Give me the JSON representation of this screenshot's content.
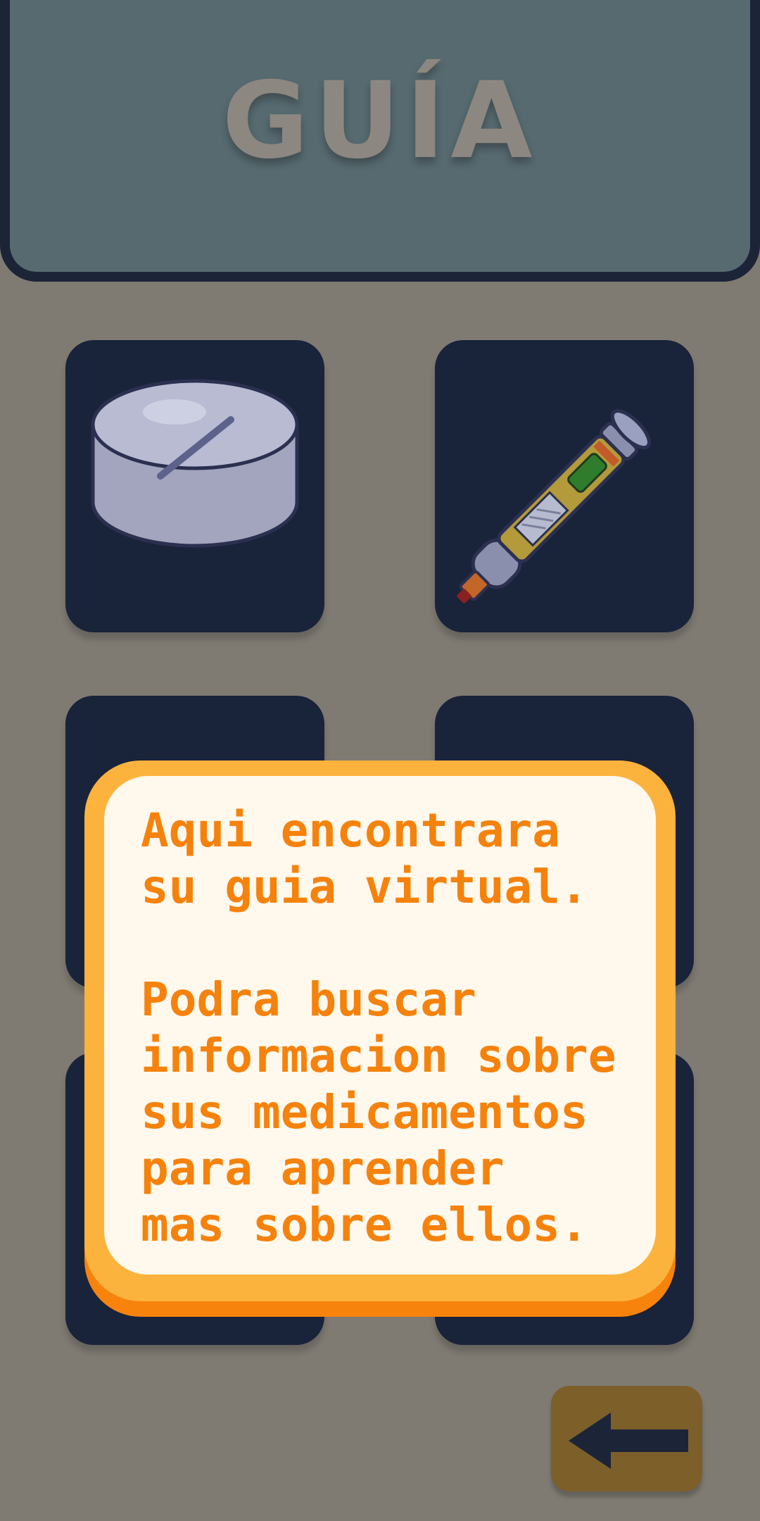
{
  "header": {
    "title": "GUÍA"
  },
  "tiles": [
    {
      "icon": "pill-tablet-icon"
    },
    {
      "icon": "insulin-pen-icon"
    },
    {
      "icon": "hidden-icon"
    },
    {
      "icon": "hidden-icon"
    },
    {
      "icon": "hidden-icon"
    },
    {
      "icon": "hidden-icon"
    }
  ],
  "dialog": {
    "line1": "Aqui encontrara",
    "line2": "su guia virtual.",
    "line3": "Podra buscar",
    "line4": "informacion sobre",
    "line5": "sus medicamentos",
    "line6": "para aprender",
    "line7": "mas sobre ellos."
  },
  "back_button": {
    "icon": "arrow-left-icon"
  },
  "colors": {
    "background": "#7f7b73",
    "header": "#566a70",
    "tile": "#19233a",
    "dialog_border": "#fbb33e",
    "dialog_text": "#f5820c",
    "back_button": "#7d5f2a"
  }
}
